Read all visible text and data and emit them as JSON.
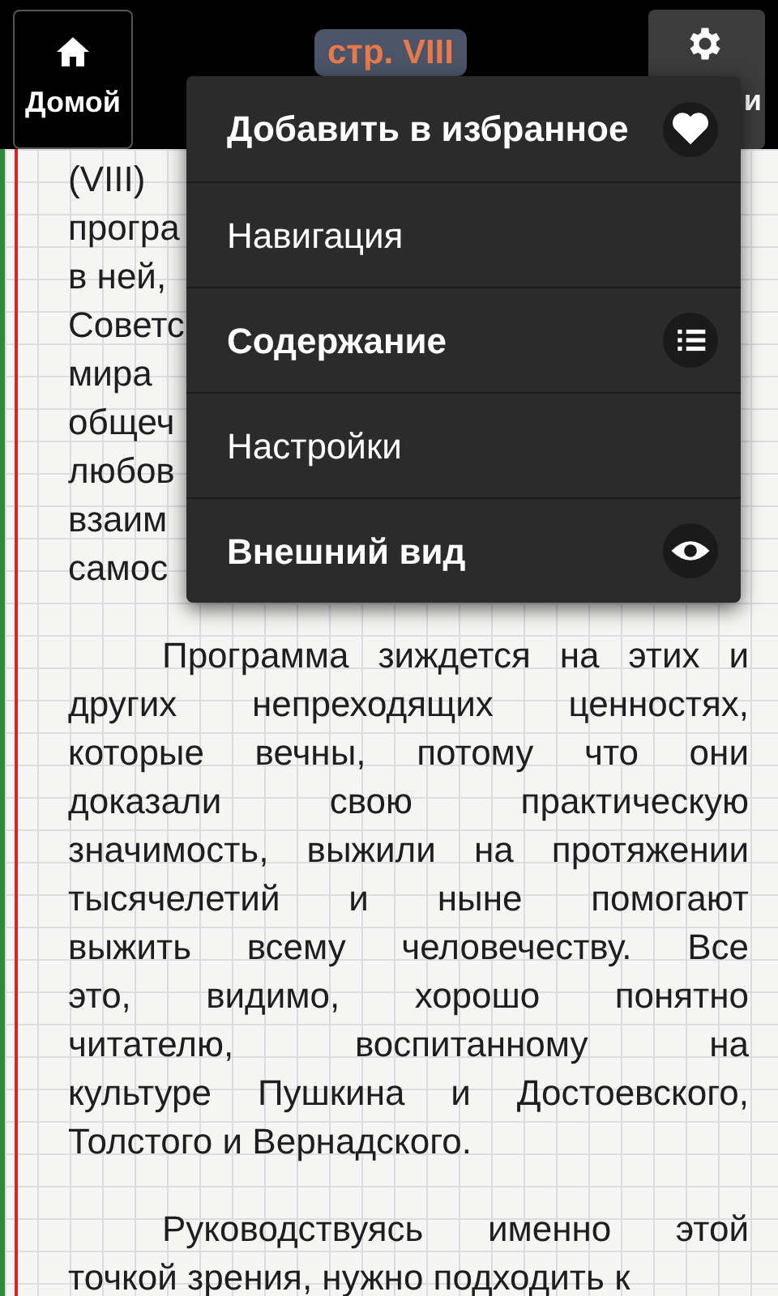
{
  "toolbar": {
    "home_button": {
      "label": "Домой"
    },
    "page_badge": "стр. VIII",
    "settings_button": {
      "label": "и"
    }
  },
  "text": {
    "paragraphs": [
      {
        "indent": false,
        "lines": [
          "(VIII)",
          "програ",
          "в ней,",
          "Советс",
          "мира",
          "общеч",
          "любов",
          "взаим",
          "самос"
        ]
      },
      {
        "indent": true,
        "lines": [
          "Программа зиждется на этих и",
          "других непреходящих ценностях,",
          "которые вечны, потому что они",
          "доказали свою практическую",
          "значимость, выжили на протяжении",
          "тысячелетий и ныне помогают",
          "выжить всему человечеству. Все",
          "это, видимо, хорошо понятно",
          "читателю, воспитанному на",
          "культуре Пушкина и Достоевского,",
          "Толстого и Вернадского."
        ]
      },
      {
        "indent": true,
        "lines": [
          "Руководствуясь именно этой",
          "точкой зрения, нужно подходить к"
        ]
      }
    ]
  },
  "menu": {
    "items": [
      {
        "label": "Добавить в избранное",
        "kind": "favorite"
      },
      {
        "label": "Навигация",
        "kind": "link"
      },
      {
        "label": "Содержание",
        "kind": "contents"
      },
      {
        "label": "Настройки",
        "kind": "link"
      },
      {
        "label": "Внешний вид",
        "kind": "appearance"
      }
    ]
  }
}
